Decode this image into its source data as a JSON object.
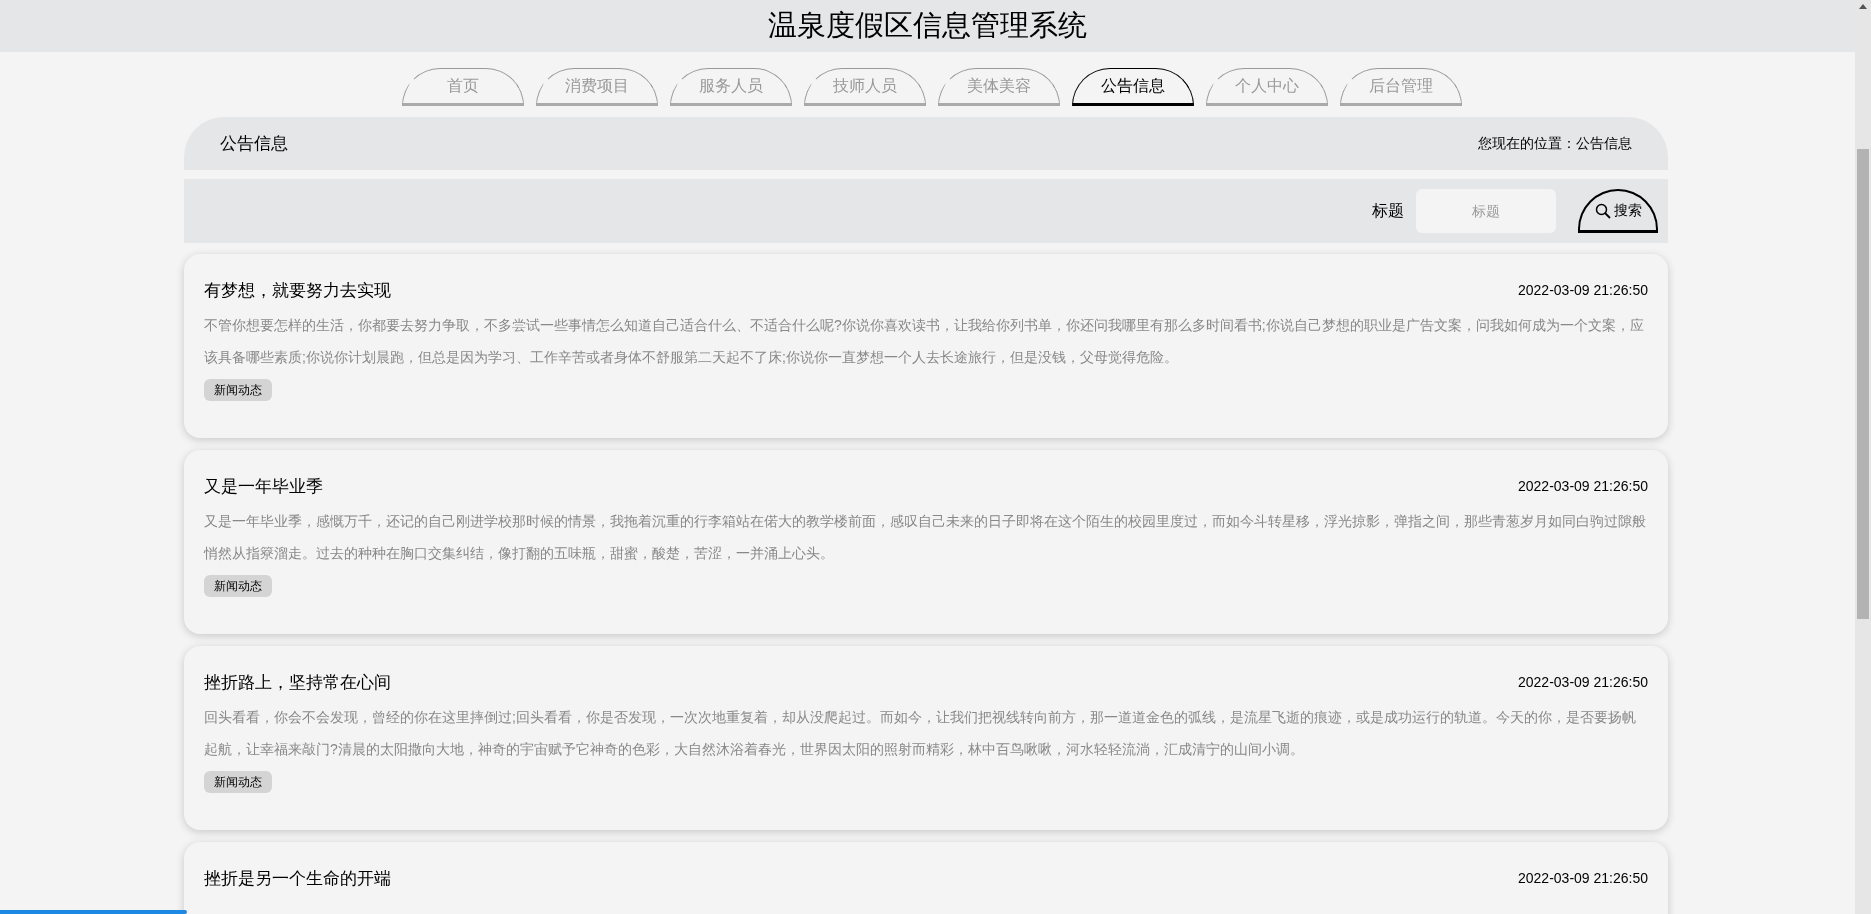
{
  "header": {
    "title": "温泉度假区信息管理系统"
  },
  "nav": [
    {
      "label": "首页",
      "selected": false
    },
    {
      "label": "消费项目",
      "selected": false
    },
    {
      "label": "服务人员",
      "selected": false
    },
    {
      "label": "技师人员",
      "selected": false
    },
    {
      "label": "美体美容",
      "selected": false
    },
    {
      "label": "公告信息",
      "selected": true
    },
    {
      "label": "个人中心",
      "selected": false
    },
    {
      "label": "后台管理",
      "selected": false
    }
  ],
  "breadcrumb": {
    "title": "公告信息",
    "location": "您现在的位置：公告信息"
  },
  "search": {
    "label": "标题",
    "placeholder": "标题",
    "button": "搜索"
  },
  "notices": [
    {
      "title": "有梦想，就要努力去实现",
      "date": "2022-03-09 21:26:50",
      "body": "不管你想要怎样的生活，你都要去努力争取，不多尝试一些事情怎么知道自己适合什么、不适合什么呢?你说你喜欢读书，让我给你列书单，你还问我哪里有那么多时间看书;你说自己梦想的职业是广告文案，问我如何成为一个文案，应该具备哪些素质;你说你计划晨跑，但总是因为学习、工作辛苦或者身体不舒服第二天起不了床;你说你一直梦想一个人去长途旅行，但是没钱，父母觉得危险。",
      "tag": "新闻动态"
    },
    {
      "title": "又是一年毕业季",
      "date": "2022-03-09 21:26:50",
      "body": "又是一年毕业季，感慨万千，还记的自己刚进学校那时候的情景，我拖着沉重的行李箱站在偌大的教学楼前面，感叹自己未来的日子即将在这个陌生的校园里度过，而如今斗转星移，浮光掠影，弹指之间，那些青葱岁月如同白驹过隙般悄然从指簝溜走。过去的种种在胸口交集纠结，像打翻的五味瓶，甜蜜，酸楚，苦涩，一并涌上心头。",
      "tag": "新闻动态"
    },
    {
      "title": "挫折路上，坚持常在心间",
      "date": "2022-03-09 21:26:50",
      "body": "回头看看，你会不会发现，曾经的你在这里摔倒过;回头看看，你是否发现，一次次地重复着，却从没爬起过。而如今，让我们把视线转向前方，那一道道金色的弧线，是流星飞逝的痕迹，或是成功运行的轨道。今天的你，是否要扬帆起航，让幸福来敲门?清晨的太阳撒向大地，神奇的宇宙赋予它神奇的色彩，大自然沐浴着春光，世界因太阳的照射而精彩，林中百鸟啾啾，河水轻轻流淌，汇成清宁的山间小调。",
      "tag": "新闻动态"
    },
    {
      "title": "挫折是另一个生命的开端",
      "date": "2022-03-09 21:26:50"
    }
  ],
  "progress": {
    "level": 0.1
  }
}
